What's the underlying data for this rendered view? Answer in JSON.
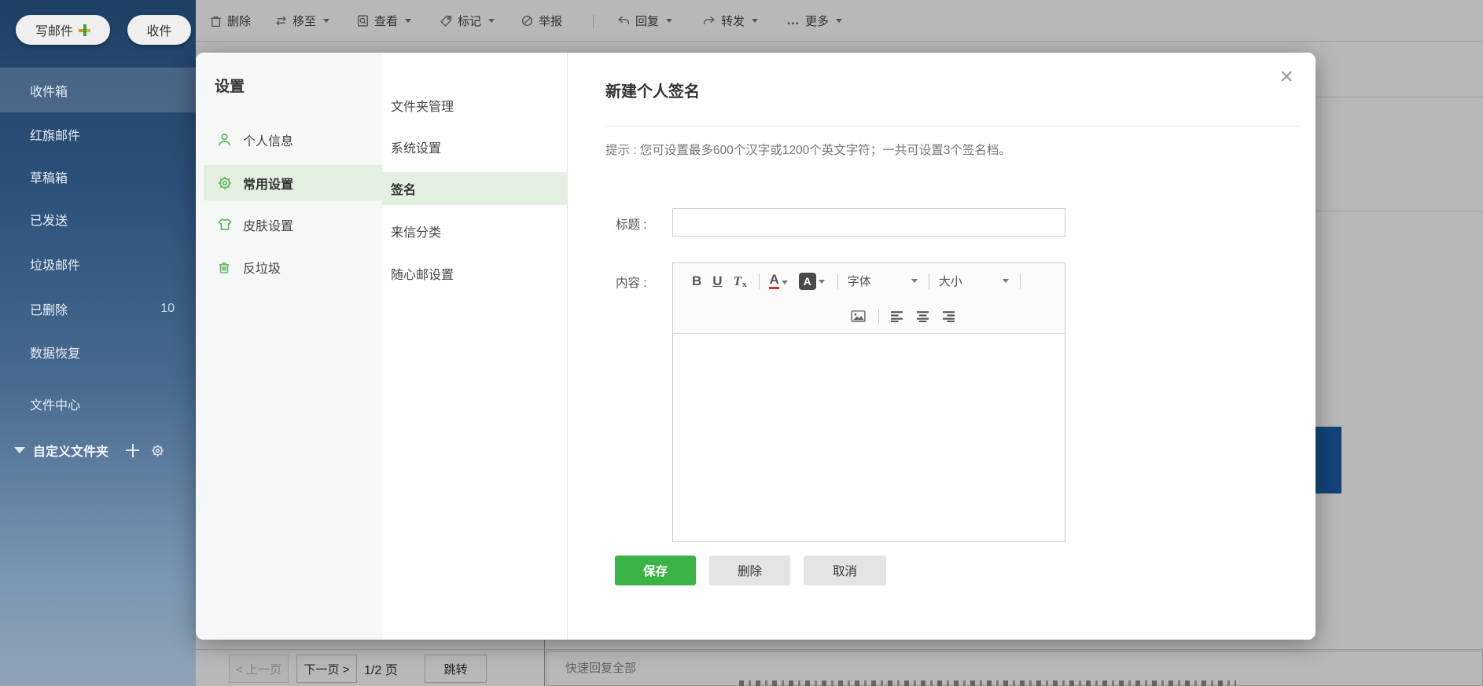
{
  "sidebar": {
    "compose_label": "写邮件",
    "receive_label": "收件",
    "folders": [
      {
        "label": "收件箱",
        "count": ""
      },
      {
        "label": "红旗邮件",
        "count": ""
      },
      {
        "label": "草稿箱",
        "count": ""
      },
      {
        "label": "已发送",
        "count": ""
      },
      {
        "label": "垃圾邮件",
        "count": ""
      },
      {
        "label": "已删除",
        "count": "10"
      },
      {
        "label": "数据恢复",
        "count": ""
      },
      {
        "label": "文件中心",
        "count": ""
      }
    ],
    "custom_folders_label": "自定义文件夹"
  },
  "toolbar": {
    "delete": "删除",
    "move": "移至",
    "view": "查看",
    "mark": "标记",
    "report": "举报",
    "reply": "回复",
    "forward": "转发",
    "more": "更多"
  },
  "settings": {
    "title": "设置",
    "nav": [
      {
        "label": "个人信息"
      },
      {
        "label": "常用设置"
      },
      {
        "label": "皮肤设置"
      },
      {
        "label": "反垃圾"
      }
    ],
    "subnav": [
      {
        "label": "文件夹管理"
      },
      {
        "label": "系统设置"
      },
      {
        "label": "签名"
      },
      {
        "label": "来信分类"
      },
      {
        "label": "随心邮设置"
      }
    ],
    "panel": {
      "title": "新建个人签名",
      "close_glyph": "×",
      "tip": "提示 : 您可设置最多600个汉字或1200个英文字符；一共可设置3个签名档。",
      "title_label": "标题 :",
      "content_label": "内容 :",
      "title_value": "",
      "editor": {
        "bold": "B",
        "underline": "U",
        "clear_main": "T",
        "clear_sub": "x",
        "color_letter": "A",
        "highlight_letter": "A",
        "font_value": "字体",
        "size_value": "大小"
      },
      "save_label": "保存",
      "delete_label": "删除",
      "cancel_label": "取消"
    }
  },
  "pagination": {
    "prev": "< 上一页",
    "next": "下一页 >",
    "page": "1/2 页",
    "jump": "跳转"
  },
  "quick_reply": {
    "label": "快速回复全部"
  },
  "colors": {
    "accent_green": "#3cb346",
    "nav_highlight_green": "#e3efe1",
    "icon_green": "#62b862",
    "sidebar_navy": "#1f4066",
    "background_blue_box": "#1b5fa8"
  }
}
